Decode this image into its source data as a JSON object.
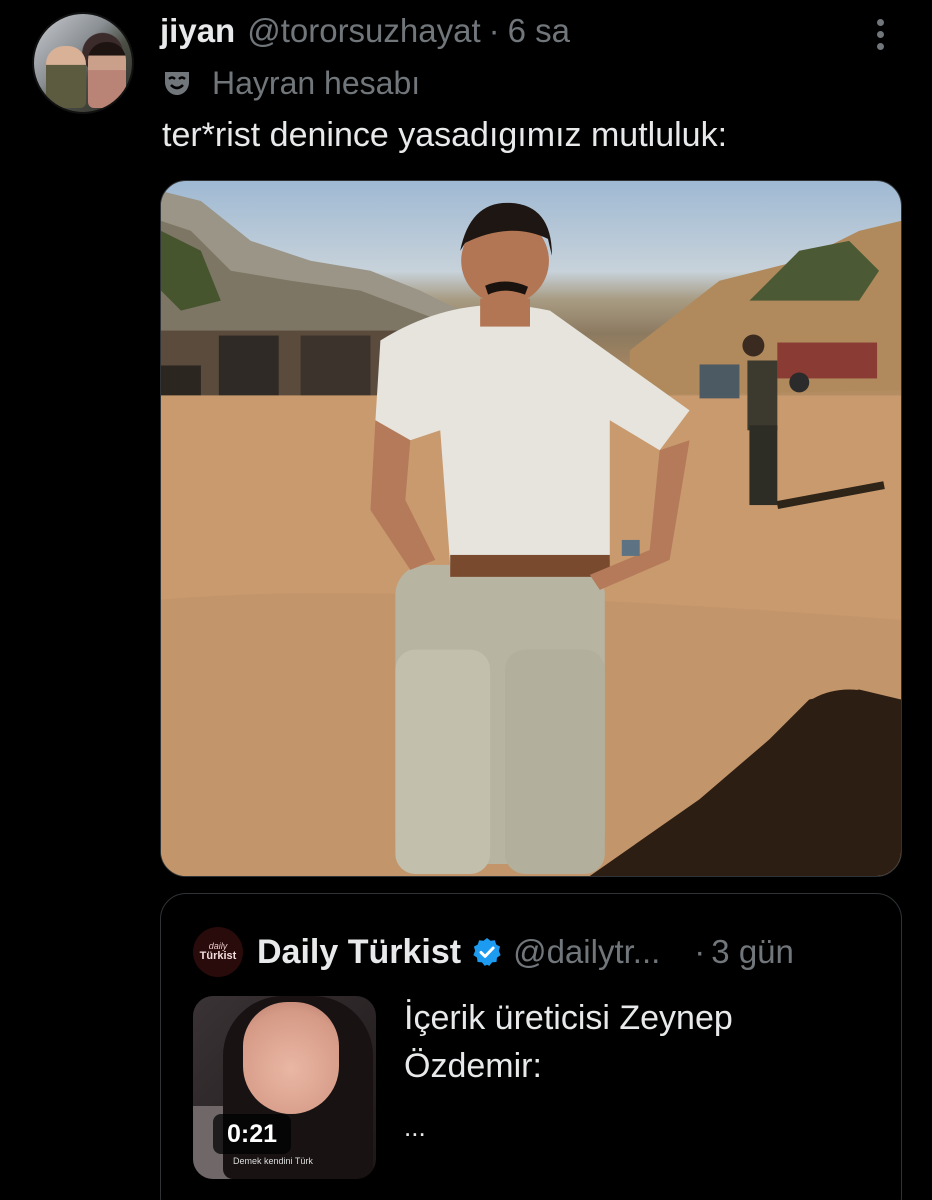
{
  "tweet": {
    "display_name": "jiyan",
    "handle": "@tororsuzhayat",
    "separator": "·",
    "time": "6 sa",
    "badge_label": "Hayran hesabı",
    "text": "ter*rist denince yasadıgımız mutluluk:",
    "image_alt": "photo"
  },
  "quoted": {
    "logo_line1": "daily",
    "logo_line2": "Türkist",
    "display_name": "Daily Türkist",
    "handle": "@dailytr...",
    "separator": "·",
    "time": "3 gün",
    "text": "İçerik üreticisi Zeynep Özdemir:",
    "ellipsis": "...",
    "video_duration": "0:21",
    "video_caption": "Demek kendini Türk"
  },
  "colors": {
    "background": "#000000",
    "primary_text": "#e7e9ea",
    "secondary_text": "#71767b",
    "border": "#2f3336",
    "verified": "#1d9bf0"
  },
  "icons": {
    "more": "more-vertical-icon",
    "badge": "mask-icon",
    "verified": "verified-badge-icon"
  }
}
